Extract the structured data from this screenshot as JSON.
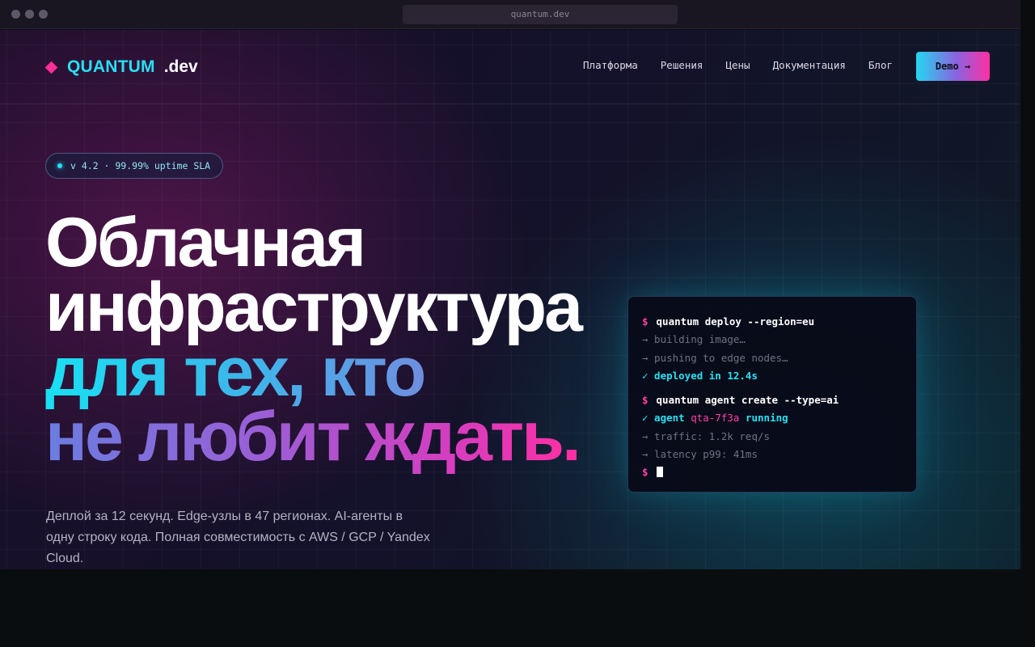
{
  "browser": {
    "url": "quantum.dev"
  },
  "nav": {
    "logo": "QUANTUM",
    "logo_suffix": ".dev",
    "menu": [
      "Платформа",
      "Решения",
      "Цены",
      "Документация",
      "Блог"
    ],
    "demo_label": "Demo →"
  },
  "badge": {
    "text": "v 4.2 · 99.99% uptime SLA"
  },
  "hero": {
    "line1": "Облачная",
    "line2": "инфраструктура",
    "line3": "для тех, кто",
    "line4": "не любит ждать."
  },
  "lead": "Деплой за 12 секунд. Edge-узлы в 47 регионах. AI-агенты в одну строку кода. Полная совместимость с AWS / GCP / Yandex Cloud.",
  "terminal": {
    "prompt": "$",
    "cmd1": "quantum deploy --region=eu",
    "info1": "→ building image…",
    "info2": "→ pushing to edge nodes…",
    "ok1": "✓ deployed in 12.4s",
    "cmd2": "quantum agent create --type=ai",
    "ok2_prefix": "✓ agent",
    "ok2_id": "qta-7f3a",
    "ok2_suffix": "running",
    "info3": "→ traffic: 1.2k req/s",
    "info4": "→ latency p99: 41ms"
  },
  "colors": {
    "accent_cyan": "#27e0f4",
    "accent_pink": "#ff2f9a"
  }
}
